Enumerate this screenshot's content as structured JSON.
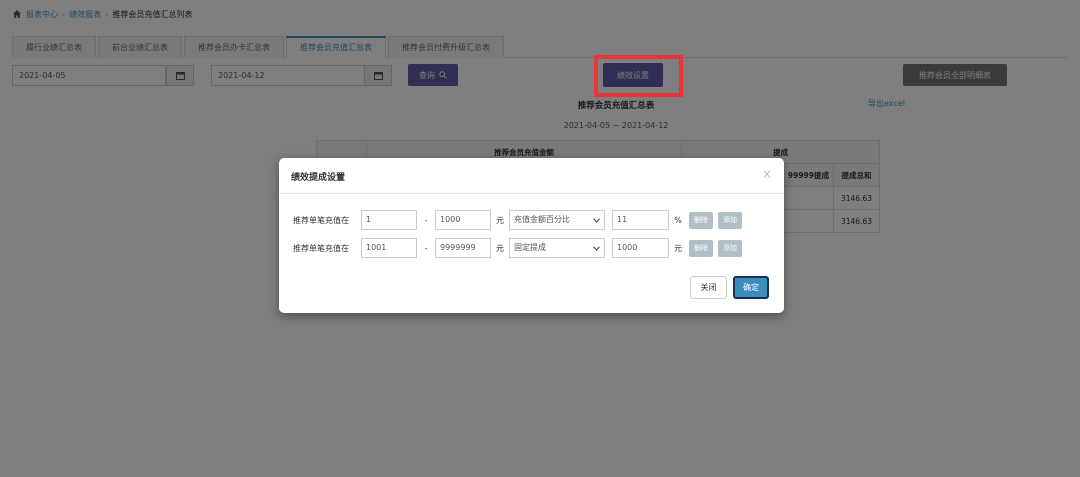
{
  "breadcrumb": [
    "报表中心",
    "绩效报表",
    "推荐会员充值汇总列表"
  ],
  "tabs": [
    "履行业绩汇总表",
    "前台业绩汇总表",
    "推荐会员办卡汇总表",
    "推荐会员充值汇总表",
    "推荐会员付费升级汇总表"
  ],
  "active_tab_index": 3,
  "filters": {
    "start_date": "2021-04-05",
    "end_date": "2021-04-12"
  },
  "buttons": {
    "query": "查询",
    "perf_settings": "绩效设置",
    "detail_report": "推荐会员全部明细表"
  },
  "report": {
    "title": "推荐会员充值汇总表",
    "range": "2021-04-05 ~ 2021-04-12",
    "export": "导出excel",
    "header_group1": "推荐会员充值金额",
    "header_group2": "提成",
    "col_partial": "99999提成",
    "col_total": "提成总和",
    "totals": [
      "3146.63",
      "3146.63"
    ]
  },
  "modal": {
    "title": "绩效提成设置",
    "close_icon": "×",
    "rules": [
      {
        "label": "推荐单笔充值在",
        "min": "1",
        "max": "1000",
        "unit": "元",
        "type": "充值金额百分比",
        "value": "11",
        "suffix": "%",
        "delete": "删除",
        "add": "添加"
      },
      {
        "label": "推荐单笔充值在",
        "min": "1001",
        "max": "9999999",
        "unit": "元",
        "type": "固定提成",
        "value": "1000",
        "suffix": "元",
        "delete": "删除",
        "add": "添加"
      }
    ],
    "close_button": "关闭",
    "confirm_button": "确定"
  },
  "colors": {
    "accent": "#3c8dbc",
    "purple": "#605ca8",
    "highlight": "#e8343a"
  }
}
